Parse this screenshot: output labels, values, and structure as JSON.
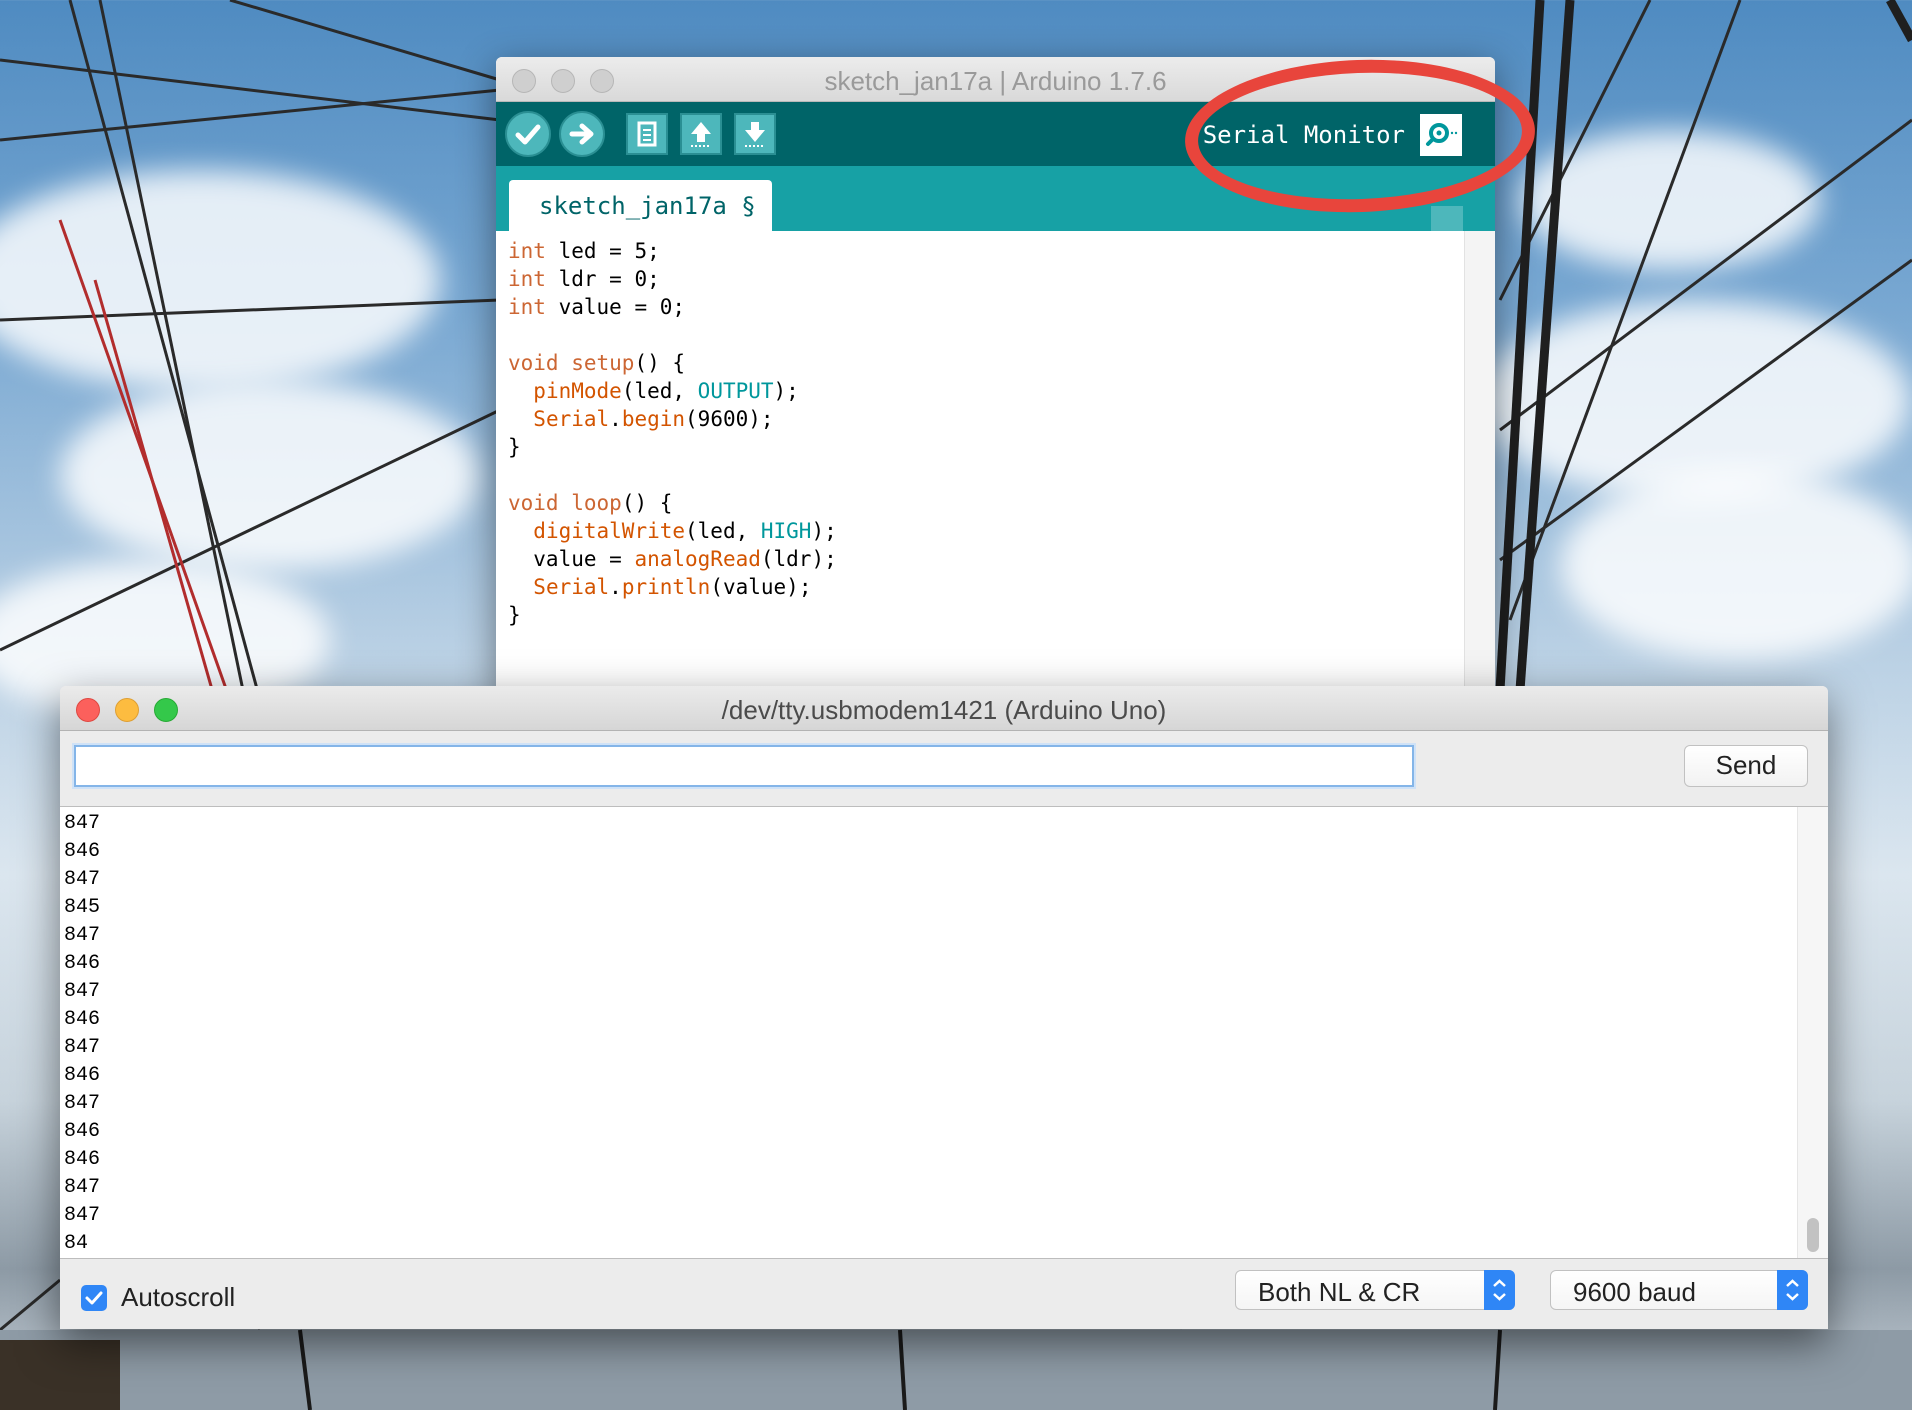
{
  "ide_window": {
    "title": "sketch_jan17a | Arduino 1.7.6",
    "toolbar": {
      "verify_icon": "checkmark-icon",
      "upload_icon": "arrow-right-icon",
      "new_icon": "document-icon",
      "open_icon": "arrow-up-icon",
      "save_icon": "arrow-down-icon",
      "serial_monitor_label": "Serial Monitor",
      "serial_monitor_icon": "magnifier-icon"
    },
    "tab_label": "sketch_jan17a §",
    "code_lines": [
      [
        [
          "kw",
          "int"
        ],
        [
          "t",
          " led = 5;"
        ]
      ],
      [
        [
          "kw",
          "int"
        ],
        [
          "t",
          " ldr = 0;"
        ]
      ],
      [
        [
          "kw",
          "int"
        ],
        [
          "t",
          " value = 0;"
        ]
      ],
      [],
      [
        [
          "kw",
          "void"
        ],
        [
          "t",
          " "
        ],
        [
          "kw",
          "setup"
        ],
        [
          "t",
          "() {"
        ]
      ],
      [
        [
          "t",
          "  "
        ],
        [
          "fn",
          "pinMode"
        ],
        [
          "t",
          "(led, "
        ],
        [
          "cn",
          "OUTPUT"
        ],
        [
          "t",
          ");"
        ]
      ],
      [
        [
          "t",
          "  "
        ],
        [
          "fn",
          "Serial"
        ],
        [
          "t",
          "."
        ],
        [
          "fn",
          "begin"
        ],
        [
          "t",
          "(9600);"
        ]
      ],
      [
        [
          "t",
          "}"
        ]
      ],
      [],
      [
        [
          "kw",
          "void"
        ],
        [
          "t",
          " "
        ],
        [
          "kw",
          "loop"
        ],
        [
          "t",
          "() {"
        ]
      ],
      [
        [
          "t",
          "  "
        ],
        [
          "fn",
          "digitalWrite"
        ],
        [
          "t",
          "(led, "
        ],
        [
          "cn",
          "HIGH"
        ],
        [
          "t",
          ");"
        ]
      ],
      [
        [
          "t",
          "  value = "
        ],
        [
          "fn",
          "analogRead"
        ],
        [
          "t",
          "(ldr);"
        ]
      ],
      [
        [
          "t",
          "  "
        ],
        [
          "fn",
          "Serial"
        ],
        [
          "t",
          "."
        ],
        [
          "fn",
          "println"
        ],
        [
          "t",
          "(value);"
        ]
      ],
      [
        [
          "t",
          "}"
        ]
      ]
    ]
  },
  "serial_monitor": {
    "title": "/dev/tty.usbmodem1421 (Arduino Uno)",
    "input_value": "",
    "send_label": "Send",
    "output_lines": [
      "847",
      "846",
      "847",
      "845",
      "847",
      "846",
      "847",
      "846",
      "847",
      "846",
      "847",
      "846",
      "846",
      "847",
      "847",
      "84"
    ],
    "autoscroll_label": "Autoscroll",
    "autoscroll_checked": true,
    "line_ending": "Both NL & CR",
    "baud_rate": "9600 baud"
  },
  "colors": {
    "arduino_dark_teal": "#006468",
    "arduino_tab_teal": "#17a1a5",
    "highlight_red": "#e8453c",
    "mac_select_blue": "#2f86f6"
  }
}
